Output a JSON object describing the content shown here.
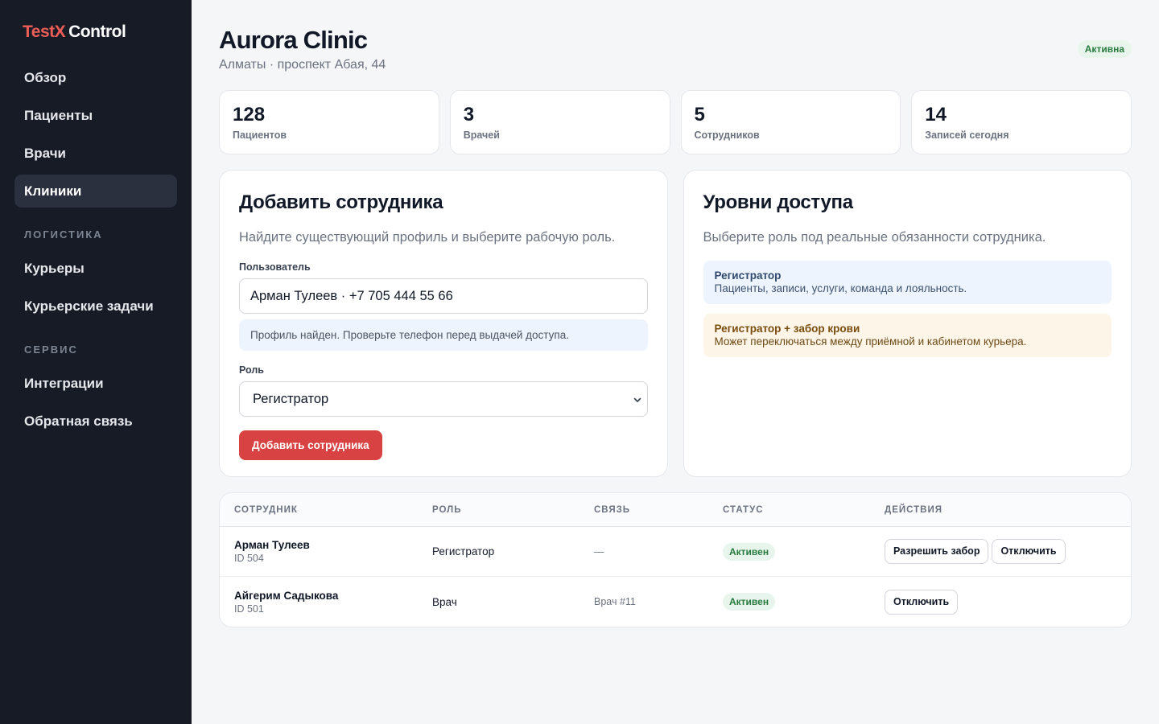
{
  "app": {
    "logo_part1": "TestX",
    "logo_part2": "Control"
  },
  "sidebar": {
    "items_main": [
      {
        "label": "Обзор"
      },
      {
        "label": "Пациенты"
      },
      {
        "label": "Врачи"
      },
      {
        "label": "Клиники",
        "active": true
      }
    ],
    "section_logistics": "Логистика",
    "items_logistics": [
      {
        "label": "Курьеры"
      },
      {
        "label": "Курьерские задачи"
      }
    ],
    "section_service": "Сервис",
    "items_service": [
      {
        "label": "Интеграции"
      },
      {
        "label": "Обратная связь"
      }
    ]
  },
  "header": {
    "title": "Aurora Clinic",
    "subtitle": "Алматы · проспект Абая, 44",
    "status_badge": "Активна"
  },
  "stats": [
    {
      "value": "128",
      "label": "Пациентов"
    },
    {
      "value": "3",
      "label": "Врачей"
    },
    {
      "value": "5",
      "label": "Сотрудников"
    },
    {
      "value": "14",
      "label": "Записей сегодня"
    }
  ],
  "add_staff": {
    "title": "Добавить сотрудника",
    "description": "Найдите существующий профиль и выберите рабочую роль.",
    "user_label": "Пользователь",
    "user_value": "Арман Тулеев · +7 705 444 55 66",
    "hint": "Профиль найден. Проверьте телефон перед выдачей доступа.",
    "role_label": "Роль",
    "role_value": "Регистратор",
    "submit_label": "Добавить сотрудника"
  },
  "access_levels": {
    "title": "Уровни доступа",
    "description": "Выберите роль под реальные обязанности сотрудника.",
    "roles": [
      {
        "name": "Регистратор",
        "text": "Пациенты, записи, услуги, команда и лояльность.",
        "color": "#eef4fd"
      },
      {
        "name": "Регистратор + забор крови",
        "text": "Может переключаться между приёмной и кабинетом курьера.",
        "color": "#fdf5e7"
      }
    ]
  },
  "staff_table": {
    "columns": [
      "Сотрудник",
      "Роль",
      "Связь",
      "Статус",
      "Действия"
    ],
    "rows": [
      {
        "name": "Арман Тулеев",
        "id": "ID 504",
        "role": "Регистратор",
        "link": "—",
        "status": "Активен",
        "actions": [
          "Разрешить забор",
          "Отключить"
        ]
      },
      {
        "name": "Айгерим Садыкова",
        "id": "ID 501",
        "role": "Врач",
        "link": "Врач #11",
        "status": "Активен",
        "actions": [
          "Отключить"
        ]
      }
    ]
  },
  "icons": {
    "select_chevron": "chevron-down-icon"
  },
  "colors": {
    "sidebar_bg": "#161b26",
    "brand_accent": "#ef5d57",
    "primary_button": "#d94242",
    "status_active_bg": "#e8f5ec",
    "status_active_text": "#287a3f"
  }
}
